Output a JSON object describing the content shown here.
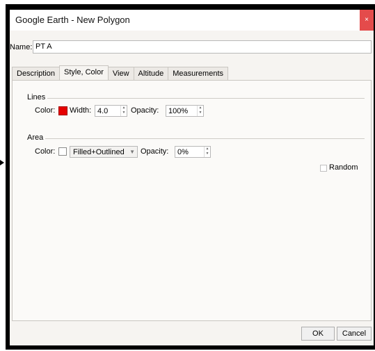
{
  "window": {
    "title": "Google Earth - New Polygon",
    "close_glyph": "×"
  },
  "name": {
    "label": "Name:",
    "value": "PT A"
  },
  "tabs": [
    {
      "label": "Description",
      "active": false
    },
    {
      "label": "Style, Color",
      "active": true
    },
    {
      "label": "View",
      "active": false
    },
    {
      "label": "Altitude",
      "active": false
    },
    {
      "label": "Measurements",
      "active": false
    }
  ],
  "lines": {
    "group_label": "Lines",
    "color_label": "Color:",
    "color": "#e60000",
    "width_label": "Width:",
    "width_value": "4.0",
    "opacity_label": "Opacity:",
    "opacity_value": "100%"
  },
  "area": {
    "group_label": "Area",
    "color_label": "Color:",
    "color": "#ffffff",
    "fill_mode": "Filled+Outlined",
    "opacity_label": "Opacity:",
    "opacity_value": "0%"
  },
  "random": {
    "label": "Random",
    "checked": false
  },
  "buttons": {
    "ok": "OK",
    "cancel": "Cancel"
  },
  "icons": {
    "spin": "spin-arrows-icon",
    "dropdown": "chevron-down-icon"
  }
}
